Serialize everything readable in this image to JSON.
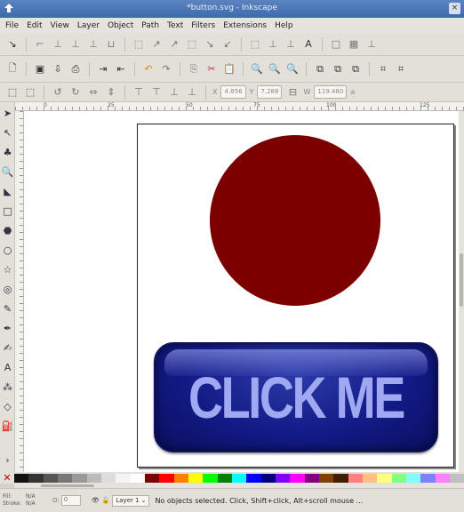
{
  "window": {
    "title": "*button.svg - Inkscape",
    "close_glyph": "×"
  },
  "menu": [
    "File",
    "Edit",
    "View",
    "Layer",
    "Object",
    "Path",
    "Text",
    "Filters",
    "Extensions",
    "Help"
  ],
  "tool_controls": {
    "x_label": "X",
    "x_value": "4.856",
    "y_label": "Y",
    "y_value": "7.288",
    "w_label": "W",
    "w_value": "119.480",
    "a_label": "a"
  },
  "ruler_labels": [
    "0",
    "25",
    "50",
    "75",
    "100",
    "125"
  ],
  "canvas": {
    "circle_color": "#7d0000",
    "button_text": "CLICK ME",
    "button_color": "#121a86",
    "button_text_color": "#9fa8f0"
  },
  "palette_colors": [
    "#111111",
    "#333333",
    "#555555",
    "#777777",
    "#999999",
    "#bbbbbb",
    "#dddddd",
    "#f4f4f4",
    "#ffffff",
    "#800000",
    "#ff0000",
    "#ff8000",
    "#ffff00",
    "#00ff00",
    "#008000",
    "#00ffff",
    "#0000ff",
    "#000080",
    "#8000ff",
    "#ff00ff",
    "#800080",
    "#804000",
    "#402000",
    "#ff8080",
    "#ffc080",
    "#ffff80",
    "#80ff80",
    "#80ffff",
    "#8080ff",
    "#ff80ff",
    "#c0c0c0"
  ],
  "status": {
    "fill_label": "Fill:",
    "fill_value": "N/A",
    "stroke_label": "Stroke:",
    "stroke_value": "N/A",
    "opacity_label": "O:",
    "opacity_value": "0",
    "layer_name": "Layer 1",
    "message": "No objects selected. Click, Shift+click, Alt+scroll mouse ..."
  }
}
